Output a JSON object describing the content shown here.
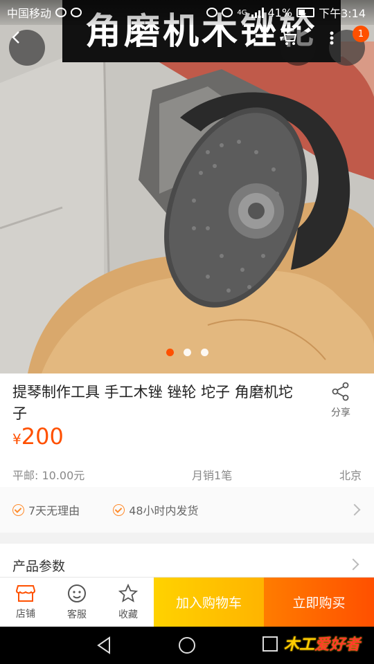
{
  "status_bar": {
    "carrier": "中国移动",
    "network": "4G",
    "battery": "41%",
    "time": "下午3:14"
  },
  "hero": {
    "caption": "角磨机木锉轮",
    "cart_badge": "1",
    "dots": {
      "count": 3,
      "active": 0
    },
    "icons": {
      "back": "chevron-left-icon",
      "cart": "cart-icon",
      "more": "more-vertical-icon"
    }
  },
  "product": {
    "title": "提琴制作工具 手工木锉 锉轮 坨子 角磨机坨子",
    "price_currency": "¥",
    "price_amount": "200",
    "share_label": "分享",
    "shipping": "平邮: 10.00元",
    "monthly_sales": "月销1笔",
    "location": "北京"
  },
  "guarantees": [
    {
      "label": "7天无理由"
    },
    {
      "label": "48小时内发货"
    }
  ],
  "params": {
    "label": "产品参数"
  },
  "action_bar": {
    "shop_label": "店铺",
    "service_label": "客服",
    "favorite_label": "收藏",
    "add_cart_label": "加入购物车",
    "buy_now_label": "立即购买"
  },
  "watermark": "爱好者",
  "colors": {
    "accent": "#ff5000",
    "add_cart": "#ffc400",
    "check": "#ff8a2a"
  }
}
